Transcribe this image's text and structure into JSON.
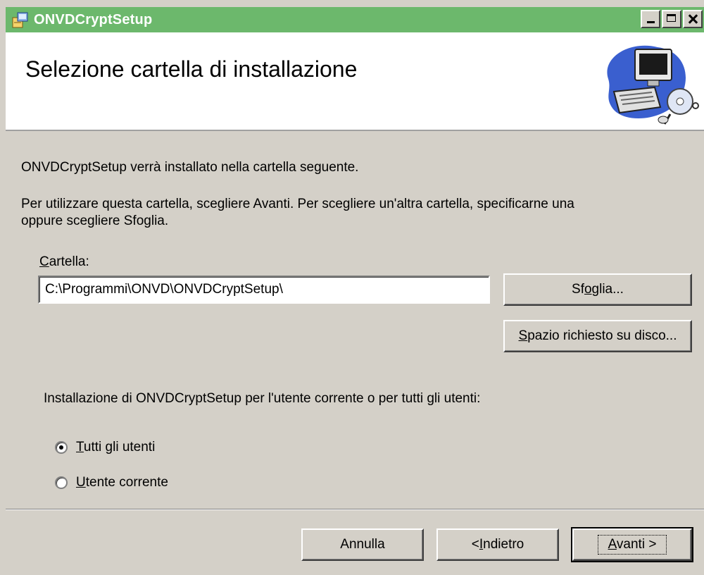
{
  "window": {
    "title": "ONVDCryptSetup"
  },
  "banner": {
    "title": "Selezione cartella di installazione"
  },
  "content": {
    "intro": "ONVDCryptSetup verrà installato nella cartella seguente.",
    "instructions_line1": "Per utilizzare questa cartella, scegliere Avanti. Per scegliere un'altra cartella, specificarne una",
    "instructions_line2": "oppure scegliere Sfoglia.",
    "folder_label_accel": "C",
    "folder_label_rest": "artella:",
    "folder_value": "C:\\Programmi\\ONVD\\ONVDCryptSetup\\",
    "browse_pre": "Sf",
    "browse_accel": "o",
    "browse_post": "glia...",
    "disk_accel": "S",
    "disk_rest": "pazio richiesto su disco...",
    "install_for": "Installazione di ONVDCryptSetup per l'utente corrente o per tutti gli utenti:",
    "radio_all_accel": "T",
    "radio_all_rest": "utti gli utenti",
    "radio_current_accel": "U",
    "radio_current_rest": "tente corrente"
  },
  "footer": {
    "cancel": "Annulla",
    "back_pre": "< ",
    "back_accel": "I",
    "back_rest": "ndietro",
    "next_accel": "A",
    "next_rest": "vanti >"
  },
  "colors": {
    "titlebar": "#6cb86c",
    "face": "#d4d0c8"
  }
}
